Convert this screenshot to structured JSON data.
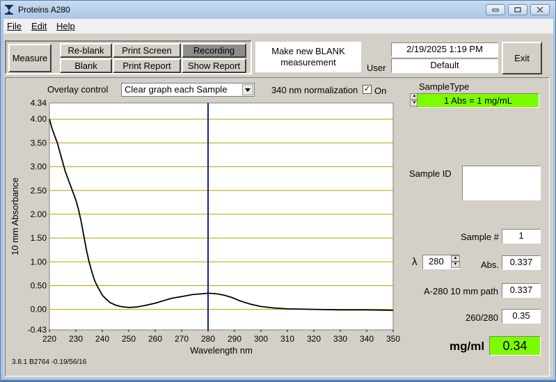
{
  "window": {
    "title": "Proteins A280"
  },
  "menu": [
    "File",
    "Edit",
    "Help"
  ],
  "toolbar": {
    "measure": "Measure",
    "reblank": "Re-blank",
    "blank": "Blank",
    "print_screen": "Print Screen",
    "print_report": "Print Report",
    "recording": "Recording",
    "show_report": "Show Report",
    "exit": "Exit"
  },
  "message": "Make new BLANK measurement",
  "datetime": "2/19/2025  1:19 PM",
  "user": {
    "label": "User",
    "value": "Default"
  },
  "overlay": {
    "label": "Overlay control",
    "value": "Clear graph each Sample"
  },
  "normalization": {
    "label": "340 nm normalization",
    "checked": "✓",
    "on_label": "On"
  },
  "sample_type": {
    "label": "SampleType",
    "value": "1 Abs = 1 mg/mL"
  },
  "sample_id": {
    "label": "Sample ID",
    "value": ""
  },
  "sample_number": {
    "label": "Sample #",
    "value": "1"
  },
  "lambda": {
    "symbol": "λ",
    "value": "280"
  },
  "abs": {
    "label": "Abs.",
    "value": "0.337"
  },
  "a280": {
    "label": "A-280 10 mm path",
    "value": "0.337"
  },
  "ratio": {
    "label": "260/280",
    "value": "0.35"
  },
  "concentration": {
    "label": "mg/ml",
    "value": "0.34"
  },
  "version": "3.8.1  B2764 -0.19/56/16",
  "chart_data": {
    "type": "line",
    "xlabel": "Wavelength nm",
    "ylabel": "10 mm Absorbance",
    "xlim": [
      220,
      350
    ],
    "ylim": [
      -0.43,
      4.34
    ],
    "x_ticks": [
      220,
      230,
      240,
      250,
      260,
      270,
      280,
      290,
      300,
      310,
      320,
      330,
      340,
      350
    ],
    "y_ticks": [
      -0.43,
      0.0,
      0.5,
      1.0,
      1.5,
      2.0,
      2.5,
      3.0,
      3.5,
      4.0,
      4.34
    ],
    "y_tick_labels": [
      "-0.43",
      "0.00",
      "0.50",
      "1.00",
      "1.50",
      "2.00",
      "2.50",
      "3.00",
      "3.50",
      "4.00",
      "4.34"
    ],
    "grid": "horizontal",
    "marker_x": 280,
    "series": [
      {
        "x": [
          220,
          221,
          222,
          223,
          224,
          225,
          226,
          227,
          228,
          229,
          230,
          231,
          232,
          233,
          234,
          235,
          236,
          237,
          238,
          239,
          240,
          241,
          242,
          243,
          245,
          247,
          250,
          253,
          256,
          260,
          263,
          266,
          270,
          274,
          278,
          280,
          283,
          286,
          289,
          292,
          296,
          300,
          305,
          310,
          320,
          330,
          340,
          350
        ],
        "y": [
          4.0,
          3.8,
          3.65,
          3.5,
          3.3,
          3.1,
          2.9,
          2.75,
          2.6,
          2.45,
          2.3,
          2.1,
          1.85,
          1.55,
          1.25,
          1.0,
          0.8,
          0.62,
          0.5,
          0.4,
          0.3,
          0.24,
          0.19,
          0.14,
          0.09,
          0.06,
          0.04,
          0.05,
          0.08,
          0.13,
          0.18,
          0.23,
          0.27,
          0.31,
          0.33,
          0.34,
          0.33,
          0.3,
          0.25,
          0.18,
          0.11,
          0.06,
          0.03,
          0.01,
          0.0,
          -0.01,
          -0.01,
          -0.02
        ],
        "color": "#000000"
      }
    ],
    "marker_color": "#1a1a8c",
    "grid_color": "#b8a000"
  }
}
